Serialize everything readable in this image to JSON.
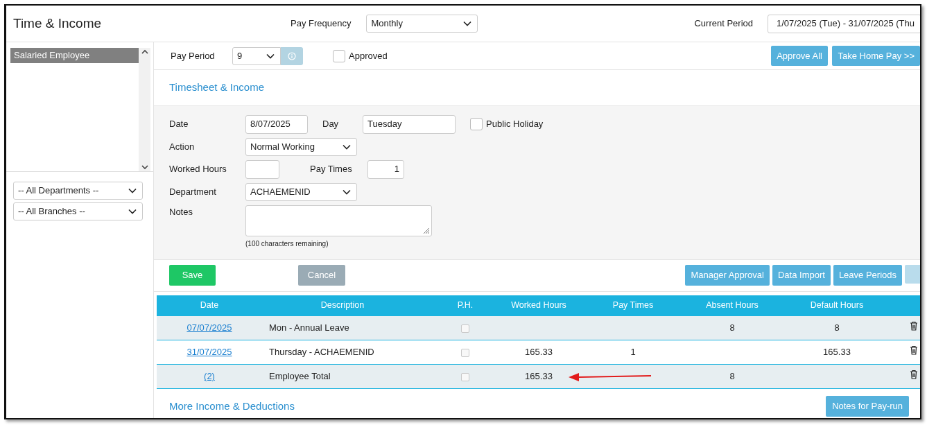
{
  "window": {
    "title": "Time & Income"
  },
  "header": {
    "pay_frequency": {
      "label": "Pay Frequency",
      "value": "Monthly"
    },
    "current_period": {
      "label": "Current Period",
      "value": "1/07/2025 (Tue) - 31/07/2025 (Thu"
    }
  },
  "sidebar": {
    "employees": [
      {
        "name": "Salaried Employee",
        "selected": true
      }
    ],
    "filters": [
      {
        "value": "-- All Departments --"
      },
      {
        "value": "-- All Branches --"
      }
    ]
  },
  "pay_period": {
    "label": "Pay Period",
    "value": "9",
    "approved": {
      "label": "Approved",
      "checked": false
    }
  },
  "top_buttons": [
    "Approve All",
    "Take Home Pay >>"
  ],
  "timesheet": {
    "title": "Timesheet & Income",
    "date": {
      "label": "Date",
      "value": "8/07/2025"
    },
    "day": {
      "label": "Day",
      "value": "Tuesday"
    },
    "public_holiday": {
      "label": "Public Holiday",
      "checked": false
    },
    "action": {
      "label": "Action",
      "value": "Normal Working"
    },
    "worked_hours": {
      "label": "Worked Hours"
    },
    "pay_times": {
      "label": "Pay Times",
      "value": "1"
    },
    "department": {
      "label": "Department",
      "value": "ACHAEMENID"
    },
    "notes": {
      "label": "Notes",
      "hint": "(100 characters remaining)"
    }
  },
  "buttons": {
    "save": "Save",
    "cancel": {
      "label": "Cancel",
      "disabled": true
    },
    "right": [
      "Manager Approval",
      "Data Import",
      "Leave Periods"
    ]
  },
  "table": {
    "columns": [
      "Date",
      "Description",
      "P.H.",
      "Worked Hours",
      "Pay Times",
      "Absent Hours",
      "Default Hours"
    ],
    "rows": [
      {
        "date": "07/07/2025",
        "description": "Mon - Annual Leave",
        "ph_checked": false,
        "absent_hours": "8",
        "default_hours": "8",
        "arrow": false
      },
      {
        "date": "31/07/2025",
        "description": "Thursday - ACHAEMENID",
        "ph_checked": false,
        "worked_hours": "165.33",
        "pay_times": "1",
        "default_hours": "165.33",
        "arrow": false
      },
      {
        "date": "(2)",
        "description": "Employee Total",
        "ph_checked": false,
        "worked_hours": "165.33",
        "absent_hours": "8",
        "arrow": true
      }
    ]
  },
  "footer": {
    "title": "More Income & Deductions",
    "button": "Notes for Pay-run"
  }
}
